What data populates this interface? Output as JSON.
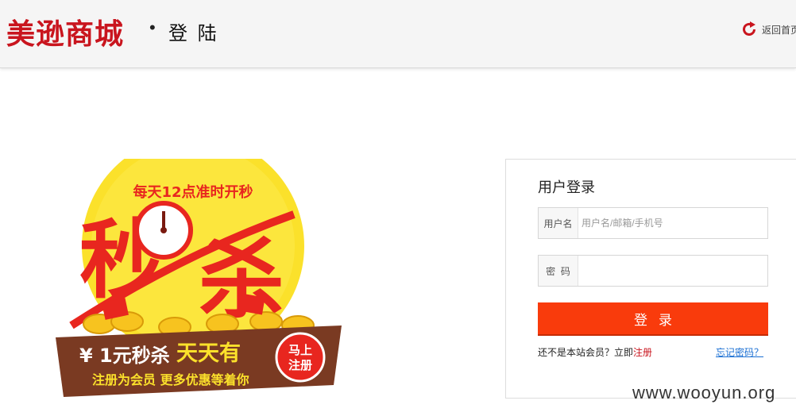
{
  "header": {
    "logo_text": "美逊商城",
    "separator": "•",
    "page_subtitle": "登 陆",
    "back_home_label": "返回首页"
  },
  "promo": {
    "top_text": "每天12点准时开秒",
    "big_text_1": "秒",
    "big_text_2": "杀",
    "banner_price": "¥ 1元秒杀",
    "banner_highlight": "天天有",
    "banner_sub": "注册为会员  更多优惠等着你",
    "badge_line1": "马上",
    "badge_line2": "注册",
    "colors": {
      "circle": "#fbe12b",
      "red": "#e8261f",
      "banner": "#7a3a22"
    }
  },
  "login": {
    "title": "用户登录",
    "username_label": "用户名",
    "username_placeholder": "用户名/邮箱/手机号",
    "password_label": "密  码",
    "password_value": "",
    "submit_label": "登录",
    "register_prompt": "还不是本站会员？立即",
    "register_link": "注册",
    "forgot_link": "忘记密码？"
  },
  "watermark": "www.wooyun.org",
  "colors": {
    "brand_red": "#c9151e",
    "button": "#f93b0c",
    "link_blue": "#1a6fd3"
  }
}
